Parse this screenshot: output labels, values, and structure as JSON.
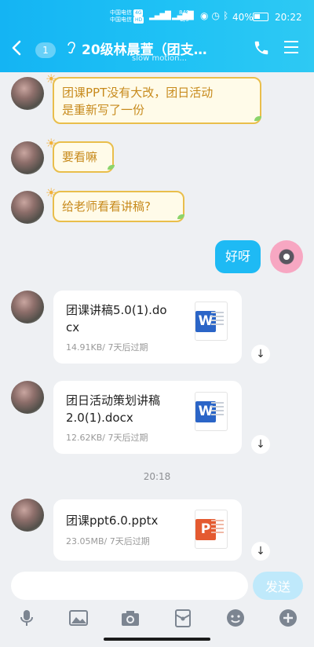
{
  "status_bar": {
    "carrier1": "中国电信",
    "carrier2": "中国电信",
    "net_tag1": "4G",
    "net_tag2": "HD",
    "speed_value": "849",
    "speed_unit": "B/s",
    "battery": "40%",
    "time": "20:22"
  },
  "header": {
    "unread_count": "1",
    "title": "20级林晨萱（团支…",
    "subtitle": "slow motion..."
  },
  "messages": [
    {
      "type": "text",
      "side": "left",
      "text_line1": "团课PPT没有大改，团日活动",
      "text_line2": "是重新写了一份"
    },
    {
      "type": "text",
      "side": "left",
      "text": "要看嘛"
    },
    {
      "type": "text",
      "side": "left",
      "text": "给老师看看讲稿?"
    },
    {
      "type": "text",
      "side": "right",
      "text": "好呀"
    },
    {
      "type": "file",
      "name_line1": "团课讲稿5.0(1).do",
      "name_line2": "cx",
      "meta": "14.91KB/ 7天后过期",
      "icon_label": "W"
    },
    {
      "type": "file",
      "name_line1": "团日活动策划讲稿",
      "name_line2": "2.0(1).docx",
      "meta": "12.62KB/ 7天后过期",
      "icon_label": "W"
    },
    {
      "type": "file",
      "name_line1": "团课ppt6.0.pptx",
      "meta": "23.05MB/ 7天后过期",
      "icon_label": "P"
    }
  ],
  "timestamp": "20:18",
  "input": {
    "value": "",
    "send_label": "发送"
  },
  "toolbar": [
    "microphone-icon",
    "image-icon",
    "camera-icon",
    "red-packet-icon",
    "emoji-icon",
    "plus-icon"
  ],
  "colors": {
    "accent": "#1ebaf4",
    "bubble_border": "#e9be4b",
    "bubble_text": "#c78a1c"
  }
}
